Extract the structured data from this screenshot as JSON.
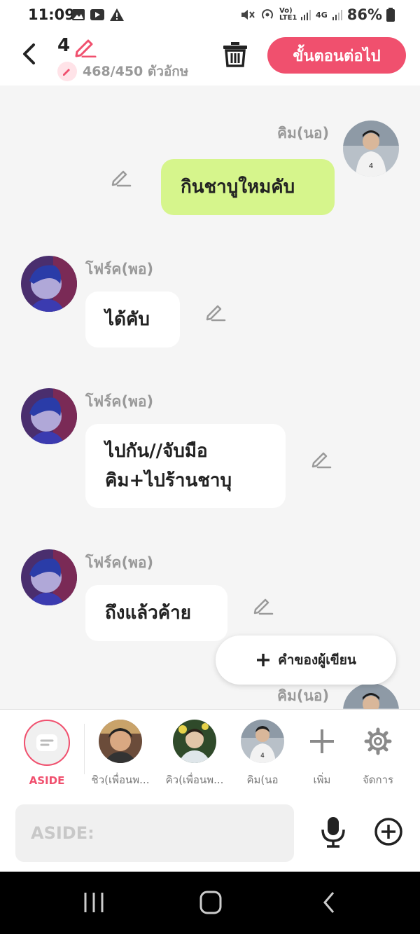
{
  "status": {
    "time": "11:09",
    "battery": "86%",
    "net1": "Vo) LTE1",
    "net2": "4G"
  },
  "header": {
    "episode": "4",
    "char_count": "468/450 ตัวอักษ",
    "next_label": "ขั้นตอนต่อไป"
  },
  "messages": [
    {
      "sender": "คิม(นอ)",
      "text": "กินชาบูใหมคับ"
    },
    {
      "sender": "โฟร์ค(พอ)",
      "text": "ได้คับ"
    },
    {
      "sender": "โฟร์ค(พอ)",
      "line1": "ไปกัน//จับมือ",
      "line2": "คิม+ไปร้านชาบุ"
    },
    {
      "sender": "โฟร์ค(พอ)",
      "text": "ถึงแล้วค้าย"
    },
    {
      "sender": "คิม(นอ)"
    }
  ],
  "aside_pill": "คำของผู้เขียน",
  "castbar": {
    "aside_label": "ASIDE",
    "cast": [
      "ชิว(เพื่อนพ...",
      "คิว(เพื่อนพ...",
      "คิม(นอ"
    ],
    "add_label": "เพิ่ม",
    "manage_label": "จัดการ"
  },
  "input": {
    "placeholder": "ASIDE:"
  },
  "colors": {
    "accent": "#f0506e",
    "outgoing_bubble": "#d6f58c"
  },
  "icons": [
    "back-icon",
    "pencil-icon",
    "trash-icon",
    "mic-icon",
    "add-circle-icon",
    "gear-icon",
    "plus-icon"
  ]
}
